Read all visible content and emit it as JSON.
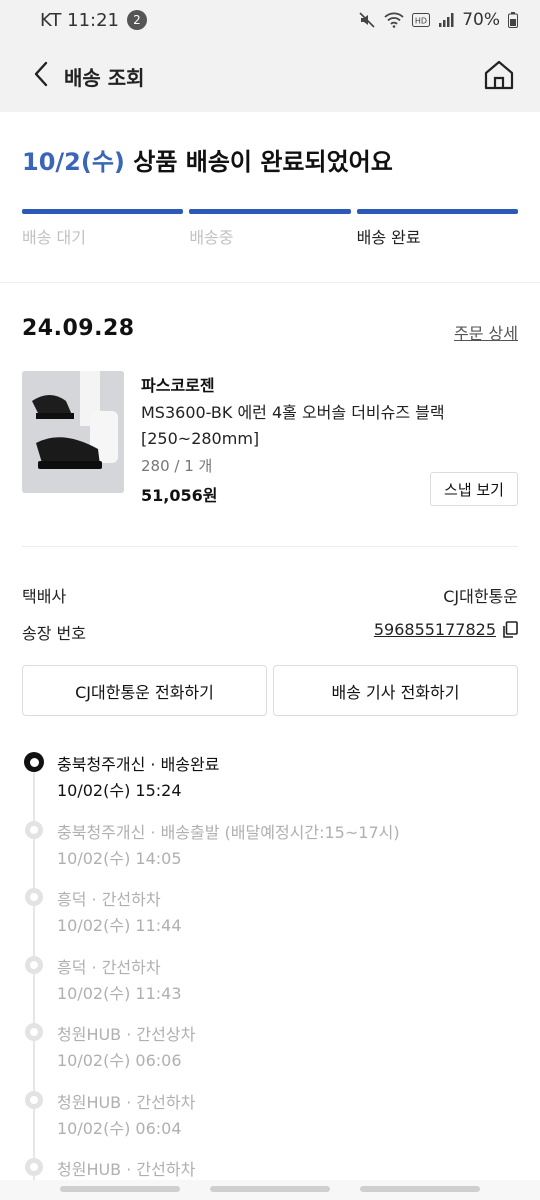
{
  "status_bar": {
    "carrier_time": "KT 11:21",
    "notification_count": "2",
    "battery": "70%",
    "icons": [
      "mute-icon",
      "wifi-icon",
      "hd-icon",
      "signal-icon",
      "battery-icon"
    ]
  },
  "header": {
    "title": "배송 조회",
    "back_icon": "chevron-left-icon",
    "home_icon": "home-icon"
  },
  "headline": {
    "date": "10/2(수)",
    "text": " 상품 배송이 완료되었어요"
  },
  "progress": {
    "steps": [
      {
        "label": "배송 대기"
      },
      {
        "label": "배송중"
      },
      {
        "label": "배송 완료"
      }
    ],
    "current_step": 3
  },
  "order": {
    "date": "24.09.28",
    "detail_link": "주문 상세",
    "product": {
      "brand": "파스코로젠",
      "name": "MS3600-BK 에런 4홀 오버솔 더비슈즈 블랙 [250~280mm]",
      "option": "280 / 1 개",
      "price": "51,056원",
      "snap_button": "스냅 보기"
    }
  },
  "delivery_info": {
    "courier_label": "택배사",
    "courier_value": "CJ대한통운",
    "tracking_label": "송장 번호",
    "tracking_number": "596855177825"
  },
  "buttons": {
    "call_courier": "CJ대한통운 전화하기",
    "call_driver": "배송 기사 전화하기"
  },
  "timeline": [
    {
      "title": "충북청주개신 · 배송완료",
      "time": "10/02(수) 15:24"
    },
    {
      "title": "충북청주개신 · 배송출발 (배달예정시간:15~17시)",
      "time": "10/02(수) 14:05"
    },
    {
      "title": "흥덕 · 간선하차",
      "time": "10/02(수) 11:44"
    },
    {
      "title": "흥덕 · 간선하차",
      "time": "10/02(수) 11:43"
    },
    {
      "title": "청원HUB · 간선상차",
      "time": "10/02(수) 06:06"
    },
    {
      "title": "청원HUB · 간선하차",
      "time": "10/02(수) 06:04"
    },
    {
      "title": "청원HUB · 간선하차",
      "time": ""
    }
  ],
  "colors": {
    "accent_blue": "#2c59b8",
    "headline_date": "#3a66b8",
    "inactive_text": "#b0b0b0"
  }
}
